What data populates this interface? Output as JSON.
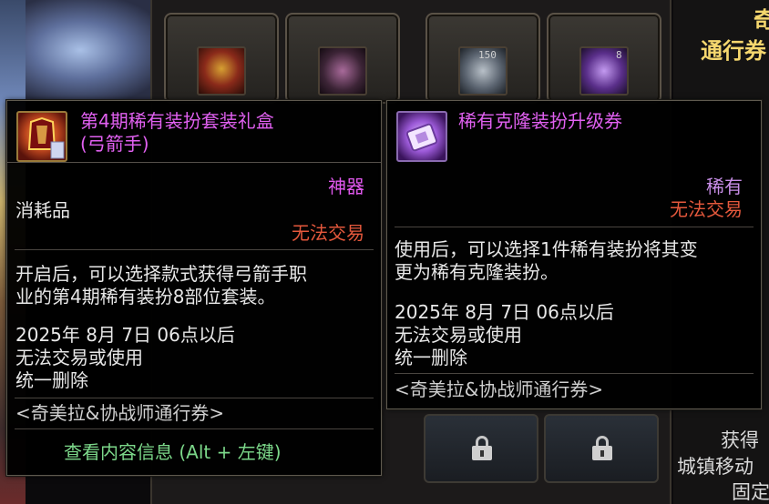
{
  "background": {
    "slot_counts": [
      "150",
      "8"
    ],
    "right_strip": {
      "top_partial": "奇",
      "header_partial": "通行券",
      "bottom_lines": [
        "获得",
        "城镇移动",
        "固定"
      ]
    }
  },
  "tooltip_left": {
    "title_line1": "第4期稀有装扮套装礼盒",
    "title_line2": "(弓箭手)",
    "rarity": "神器",
    "category": "消耗品",
    "trade": "无法交易",
    "desc_line1": "开启后，可以选择款式获得弓箭手职",
    "desc_line2": "业的第4期稀有装扮8部位套装。",
    "expiry_line1": "2025年 8月 7日 06点以后",
    "expiry_line2": "无法交易或使用",
    "expiry_line3": "统一删除",
    "source": "<奇美拉&协战师通行券>",
    "footer_action": "查看内容信息 (Alt + 左键)"
  },
  "tooltip_right": {
    "title": "稀有克隆装扮升级券",
    "rarity": "稀有",
    "trade": "无法交易",
    "desc_line1": "使用后，可以选择1件稀有装扮将其变",
    "desc_line2": "更为稀有克隆装扮。",
    "expiry_line1": "2025年 8月 7日 06点以后",
    "expiry_line2": "无法交易或使用",
    "expiry_line3": "统一删除",
    "source": "<奇美拉&协战师通行券>"
  },
  "colors": {
    "legendary_magenta": "#e158ee",
    "rare_purple": "#c98ee8",
    "untradeable_red": "#e4583c",
    "action_green": "#7cd88a"
  }
}
